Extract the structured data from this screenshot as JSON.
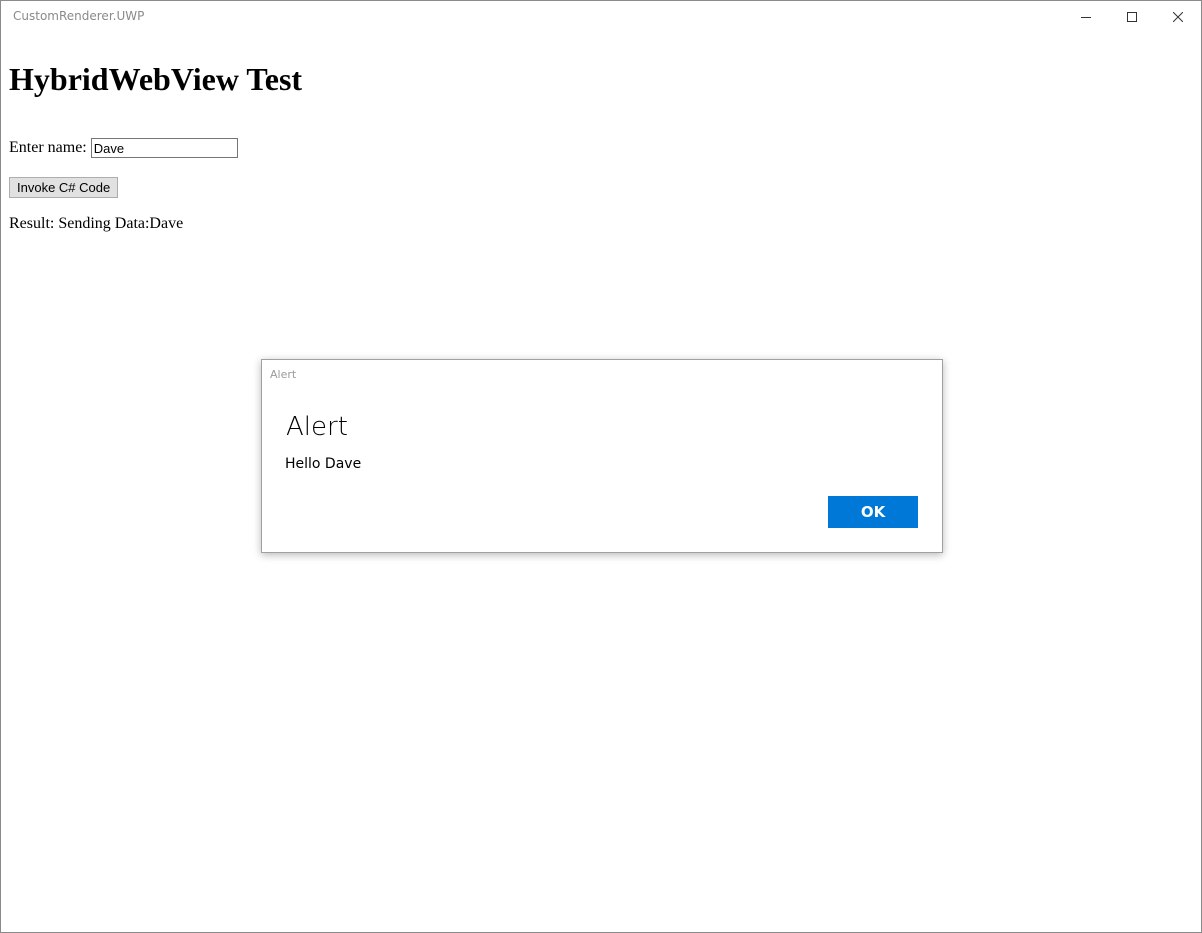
{
  "window": {
    "title": "CustomRenderer.UWP",
    "controls": {
      "minimize_icon": "minimize-icon",
      "maximize_icon": "maximize-icon",
      "close_icon": "close-icon"
    }
  },
  "page": {
    "heading": "HybridWebView Test",
    "name_label": "Enter name:",
    "name_value": "Dave",
    "invoke_button_label": "Invoke C# Code",
    "result_text": "Result: Sending Data:Dave"
  },
  "dialog": {
    "caption": "Alert",
    "title": "Alert",
    "message": "Hello Dave",
    "ok_label": "OK",
    "accent_color": "#0078d7"
  }
}
